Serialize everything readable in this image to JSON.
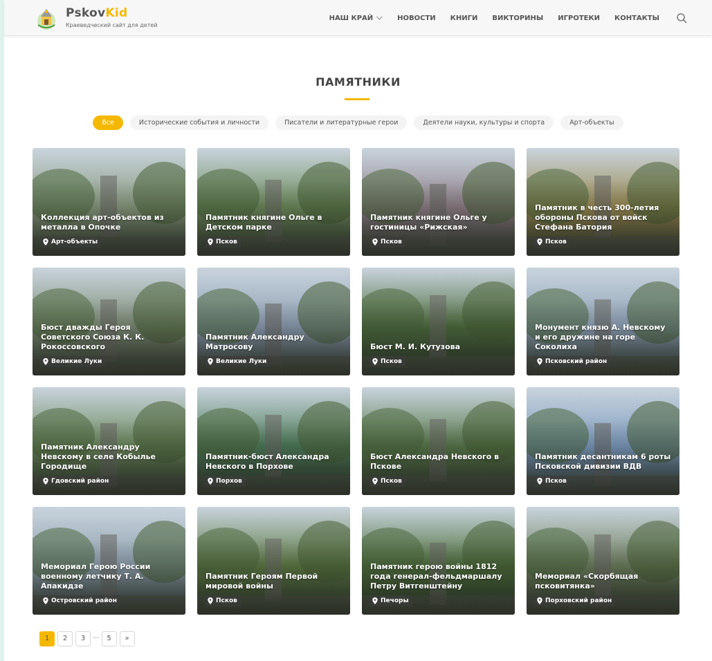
{
  "brand": {
    "name_a": "Pskov",
    "name_b": "Kid",
    "tagline": "Краеведческий сайт для детей"
  },
  "nav": {
    "items": [
      {
        "label": "НАШ КРАЙ",
        "has_dropdown": true
      },
      {
        "label": "НОВОСТИ"
      },
      {
        "label": "КНИГИ"
      },
      {
        "label": "ВИКТОРИНЫ"
      },
      {
        "label": "ИГРОТЕКИ"
      },
      {
        "label": "КОНТАКТЫ"
      }
    ],
    "search_icon": "search-icon"
  },
  "page": {
    "title": "ПАМЯТНИКИ"
  },
  "filters": [
    {
      "label": "Все",
      "active": true
    },
    {
      "label": "Исторические события и личности"
    },
    {
      "label": "Писатели и литературные герои"
    },
    {
      "label": "Деятели науки, культуры и спорта"
    },
    {
      "label": "Арт-объекты"
    }
  ],
  "cards": [
    {
      "title": "Коллекция арт-объектов из металла в Опочке",
      "tag": "Арт-объекты",
      "scene": "#8a9b80"
    },
    {
      "title": "Памятник княгине Ольге в Детском парке",
      "tag": "Псков",
      "scene": "#6f8c5d"
    },
    {
      "title": "Памятник княгине Ольге у гостиницы «Рижская»",
      "tag": "Псков",
      "scene": "#8f8088"
    },
    {
      "title": "Памятник в честь 300-летия обороны Пскова от войск Стефана Батория",
      "tag": "Псков",
      "scene": "#9a8a52"
    },
    {
      "title": "Бюст дважды Героя Советского Союза К. К. Рокоссовского",
      "tag": "Великие Луки",
      "scene": "#7e8d76"
    },
    {
      "title": "Памятник Александру Матросову",
      "tag": "Великие Луки",
      "scene": "#8e9fb3"
    },
    {
      "title": "Бюст М. И. Кутузова",
      "tag": "Псков",
      "scene": "#4f6e3f"
    },
    {
      "title": "Монумент князю А. Невскому и его дружине на горе Соколиха",
      "tag": "Псковский район",
      "scene": "#8fa3b8"
    },
    {
      "title": "Памятник Александру Невскому в селе Кобылье Городище",
      "tag": "Гдовский район",
      "scene": "#6d8a5e"
    },
    {
      "title": "Памятник-бюст Александра Невского в Порхове",
      "tag": "Порхов",
      "scene": "#4f7d5a"
    },
    {
      "title": "Бюст Александра Невского в Пскове",
      "tag": "Псков",
      "scene": "#5a7a4c"
    },
    {
      "title": "Памятник десантникам 6 роты Псковской дивизии ВДВ",
      "tag": "Псков",
      "scene": "#7d9cc0"
    },
    {
      "title": "Мемориал Герою России военному летчику Т. А. Апакидзе",
      "tag": "Островский район",
      "scene": "#8ea0ae"
    },
    {
      "title": "Памятник Героям Первой мировой войны",
      "tag": "Псков",
      "scene": "#5e7a45"
    },
    {
      "title": "Памятник герою войны 1812 года генерал-фельдмаршалу Петру Витгенштейну",
      "tag": "Печоры",
      "scene": "#4c6e3a"
    },
    {
      "title": "Мемориал «Скорбящая псковитянка»",
      "tag": "Порховский район",
      "scene": "#6e7f5e"
    }
  ],
  "pagination": {
    "pages": [
      "1",
      "2",
      "3"
    ],
    "ellipsis": "...",
    "last": "5",
    "next": "»",
    "current": "1"
  },
  "colors": {
    "accent": "#f5b800"
  }
}
